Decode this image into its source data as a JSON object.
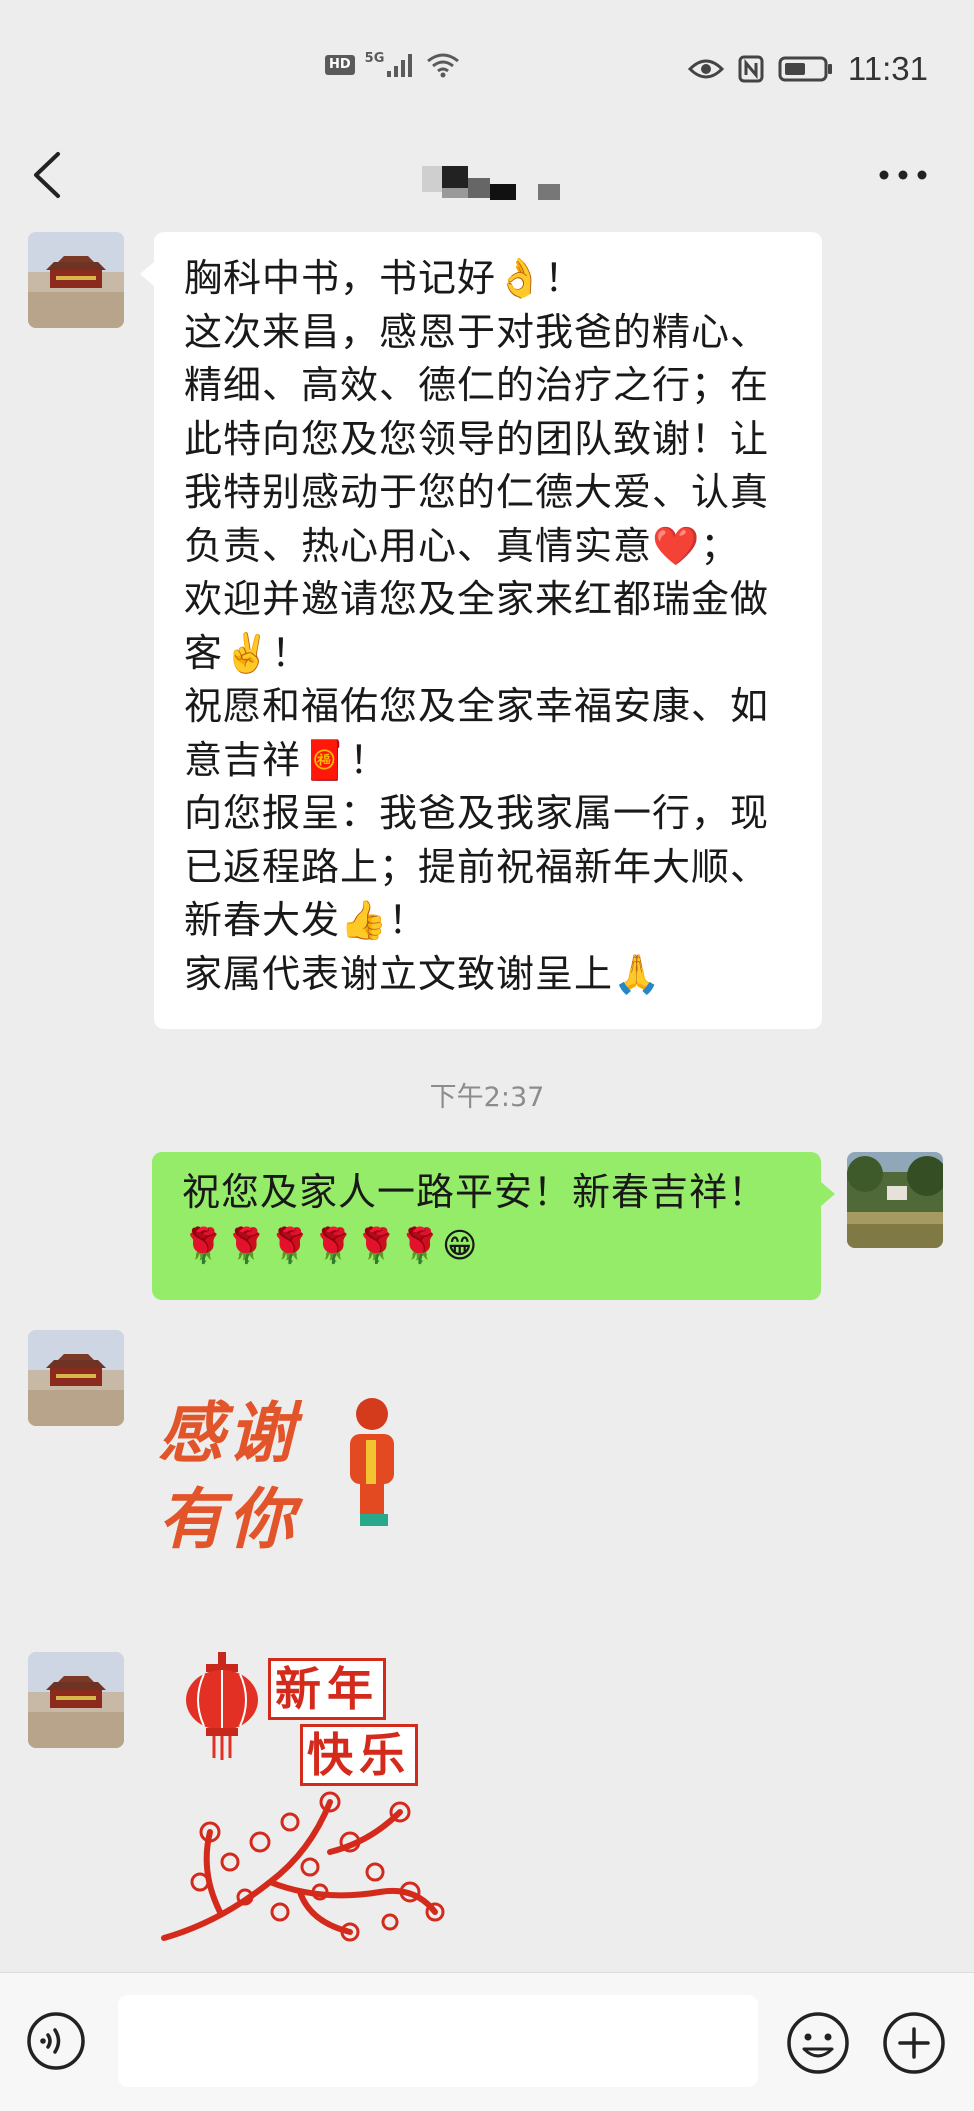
{
  "status_bar": {
    "hd": "HD",
    "network": "5G",
    "time": "11:31"
  },
  "header": {
    "title_obscured": true,
    "icons": [
      "back-arrow-icon",
      "more-dots-icon"
    ]
  },
  "messages": {
    "m1": {
      "lines": [
        "胸科中书，书记好👌！",
        "这次来昌，感恩于对我爸的精心、",
        "精细、高效、德仁的治疗之行；在",
        "此特向您及您领导的团队致谢！让",
        "我特别感动于您的仁德大爱、认真",
        "负责、热心用心、真情实意❤️；",
        "欢迎并邀请您及全家来红都瑞金做",
        "客✌️！",
        "祝愿和福佑您及全家幸福安康、如",
        "意吉祥🧧！",
        "向您报呈：我爸及我家属一行，现",
        "已返程路上；提前祝福新年大顺、",
        "新春大发👍！",
        "家属代表谢立文致谢呈上🙏"
      ]
    },
    "timestamp": "下午2:37",
    "m2": {
      "line1": "祝您及家人一路平安！新春吉祥！",
      "line2": "🌹🌹🌹🌹🌹🌹😁"
    },
    "sticker1": {
      "text": "感谢有你"
    },
    "sticker2": {
      "line1": "新年",
      "line2": "快乐"
    }
  },
  "input": {
    "placeholder": "",
    "icons": [
      "voice-icon",
      "emoji-icon",
      "plus-icon"
    ]
  }
}
